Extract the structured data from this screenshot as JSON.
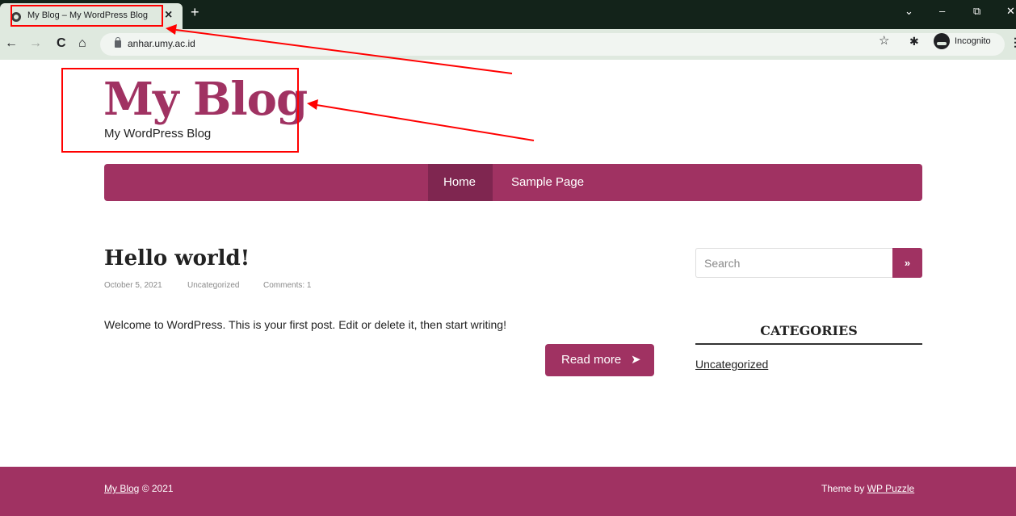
{
  "browser": {
    "tab_title": "My Blog – My WordPress Blog",
    "tab_close": "×",
    "new_tab": "+",
    "url": "anhar.umy.ac.id",
    "incognito_label": "Incognito",
    "nav_back": "←",
    "nav_forward": "→",
    "nav_reload": "C",
    "nav_home": "⌂",
    "star": "☆",
    "extensions": "✱",
    "menu": "⋮",
    "win_chevron": "⌄",
    "win_minimize": "–",
    "win_restore": "⧉",
    "win_close": "✕",
    "icons": [
      "favicon-icon",
      "back-icon",
      "forward-icon",
      "reload-icon",
      "home-icon",
      "lock-icon",
      "star-icon",
      "extensions-icon",
      "incognito-icon",
      "menu-icon"
    ]
  },
  "site": {
    "title": "My Blog",
    "tagline": "My WordPress Blog",
    "nav": [
      {
        "label": "Home",
        "active": true
      },
      {
        "label": "Sample Page",
        "active": false
      }
    ],
    "brand_color": "#a03262",
    "nav_active_color": "#7f2650"
  },
  "post": {
    "title": "Hello world!",
    "date": "October 5, 2021",
    "category": "Uncategorized",
    "comments": "Comments: 1",
    "excerpt": "Welcome to WordPress. This is your first post. Edit or delete it, then start writing!",
    "read_more": "Read more",
    "read_more_arrow": "➤"
  },
  "sidebar": {
    "search_placeholder": "Search",
    "search_button": "»",
    "categories_title": "CATEGORIES",
    "categories": [
      "Uncategorized"
    ]
  },
  "footer": {
    "site_link": "My Blog",
    "copyright": " © 2021",
    "theme_prefix": "Theme by ",
    "theme_link": "WP Puzzle"
  },
  "annotations": {
    "color": "#ff0000"
  }
}
